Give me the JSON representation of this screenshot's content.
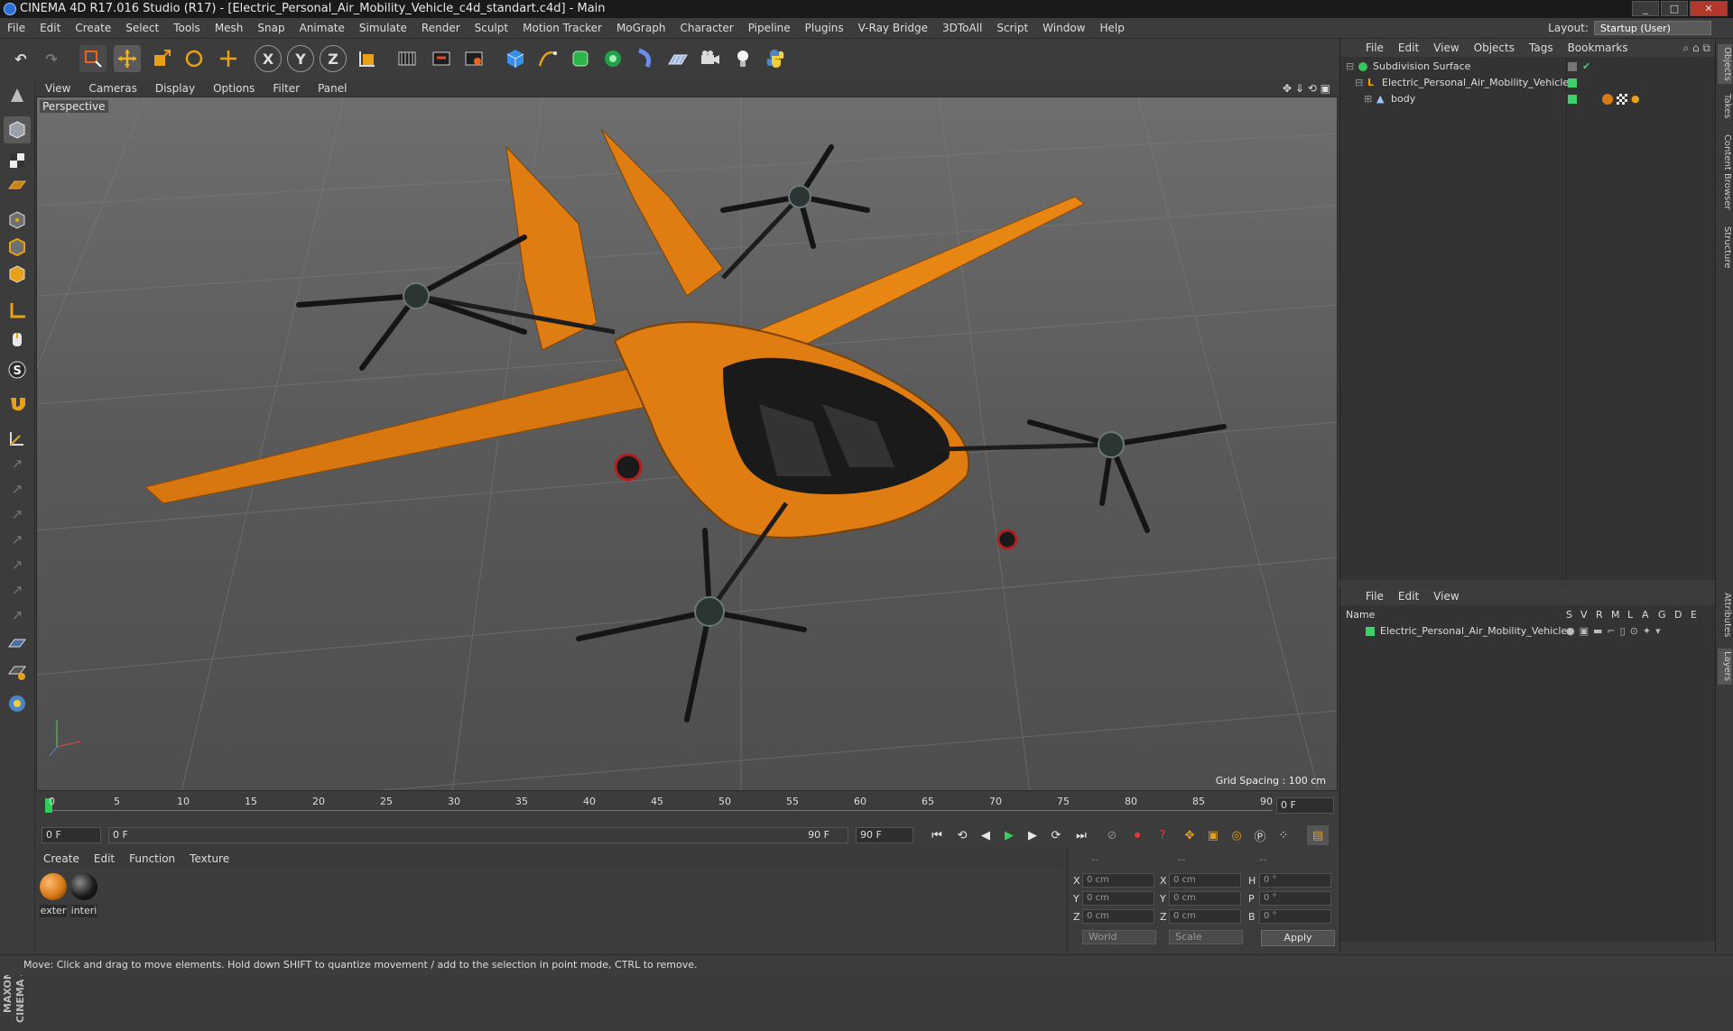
{
  "window": {
    "title": "CINEMA 4D R17.016 Studio (R17) - [Electric_Personal_Air_Mobility_Vehicle_c4d_standart.c4d] - Main",
    "min": "_",
    "max": "□",
    "close": "✕"
  },
  "menu": [
    "File",
    "Edit",
    "Create",
    "Select",
    "Tools",
    "Mesh",
    "Snap",
    "Animate",
    "Simulate",
    "Render",
    "Sculpt",
    "Motion Tracker",
    "MoGraph",
    "Character",
    "Pipeline",
    "Plugins",
    "V-Ray Bridge",
    "3DToAll",
    "Script",
    "Window",
    "Help"
  ],
  "layout": {
    "label": "Layout:",
    "value": "Startup (User)"
  },
  "toolbar": {
    "x_axis": "X",
    "y_axis": "Y",
    "z_axis": "Z"
  },
  "viewport": {
    "menu": [
      "View",
      "Cameras",
      "Display",
      "Options",
      "Filter",
      "Panel"
    ],
    "label": "Perspective",
    "grid_spacing": "Grid Spacing : 100 cm"
  },
  "timeline": {
    "ticks": [
      "0",
      "5",
      "10",
      "15",
      "20",
      "25",
      "30",
      "35",
      "40",
      "45",
      "50",
      "55",
      "60",
      "65",
      "70",
      "75",
      "80",
      "85",
      "90"
    ],
    "frame_display": "0 F",
    "start_field": "0 F",
    "range_start": "0 F",
    "range_end": "90 F",
    "end_field": "90 F"
  },
  "materials": {
    "menu": [
      "Create",
      "Edit",
      "Function",
      "Texture"
    ],
    "items": [
      {
        "label": "exter",
        "color": "#d87a16"
      },
      {
        "label": "interi",
        "color": "#1c1c1c"
      }
    ]
  },
  "coords": {
    "headers": [
      "--",
      "--",
      "--"
    ],
    "rows": [
      {
        "a": "X",
        "av": "0 cm",
        "b": "X",
        "bv": "0 cm",
        "c": "H",
        "cv": "0 °"
      },
      {
        "a": "Y",
        "av": "0 cm",
        "b": "Y",
        "bv": "0 cm",
        "c": "P",
        "cv": "0 °"
      },
      {
        "a": "Z",
        "av": "0 cm",
        "b": "Z",
        "bv": "0 cm",
        "c": "B",
        "cv": "0 °"
      }
    ],
    "space": "World",
    "mode": "Scale",
    "apply": "Apply"
  },
  "objects": {
    "menu": [
      "File",
      "Edit",
      "View",
      "Objects",
      "Tags",
      "Bookmarks"
    ],
    "rows": [
      "Subdivision Surface",
      "Electric_Personal_Air_Mobility_Vehicle",
      "body"
    ]
  },
  "layers": {
    "menu": [
      "File",
      "Edit",
      "View"
    ],
    "header_name": "Name",
    "flags": [
      "S",
      "V",
      "R",
      "M",
      "L",
      "A",
      "G",
      "D",
      "E"
    ],
    "rows": [
      "Electric_Personal_Air_Mobility_Vehicle"
    ]
  },
  "sidetabs": [
    "Objects",
    "Takes",
    "Content Browser",
    "Structure",
    "Attributes",
    "Layers"
  ],
  "brand": "MAXON CINEMA 4D",
  "status": "Move: Click and drag to move elements. Hold down SHIFT to quantize movement / add to the selection in point mode, CTRL to remove.",
  "colors": {
    "accent": "#d87a16",
    "layer_green": "#3fd16a"
  }
}
